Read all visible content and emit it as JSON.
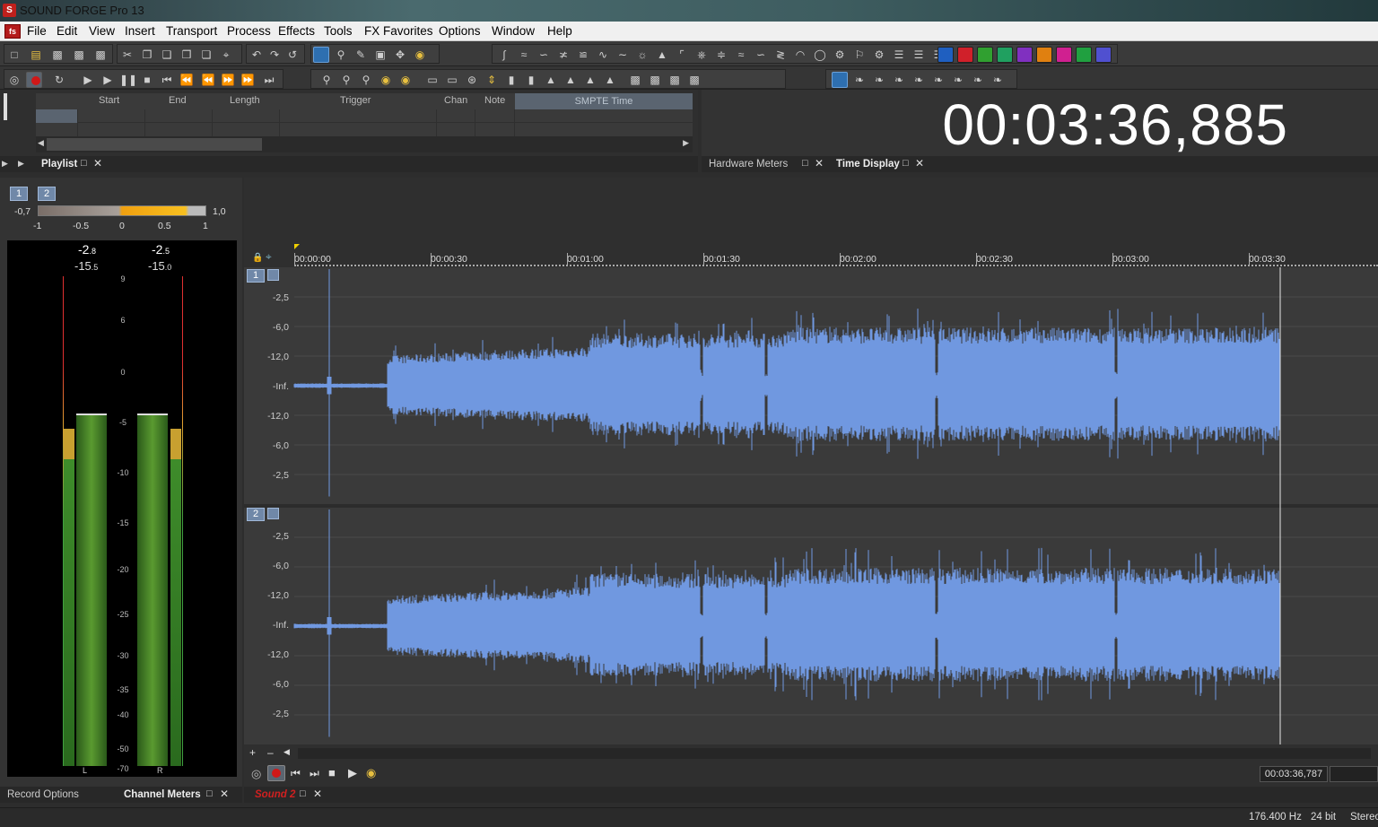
{
  "app": {
    "title": "SOUND FORGE Pro 13"
  },
  "menu": [
    "File",
    "Edit",
    "View",
    "Insert",
    "Transport",
    "Process",
    "Effects",
    "Tools",
    "FX Favorites",
    "Options",
    "Window",
    "Help"
  ],
  "playlist": {
    "columns": [
      "Start",
      "End",
      "Length",
      "Trigger",
      "Chan",
      "Note",
      "SMPTE Time"
    ],
    "tab": "Playlist"
  },
  "time_display": {
    "value": "00:03:36,885",
    "tabs": [
      "Hardware Meters",
      "Time Display"
    ]
  },
  "channel_meters": {
    "channels": [
      "1",
      "2"
    ],
    "balance": {
      "left": "-0,7",
      "right": "1,0",
      "scale": [
        "-1",
        "-0.5",
        "0",
        "0.5",
        "1"
      ]
    },
    "peak_left": {
      "big": "-2",
      "small": ".8"
    },
    "peak_right": {
      "big": "-2",
      "small": ".5"
    },
    "rms_left": {
      "big": "-15",
      "small": ".5"
    },
    "rms_right": {
      "big": "-15",
      "small": ".0"
    },
    "scale": [
      "9",
      "6",
      "0",
      "-5",
      "-10",
      "-15",
      "-20",
      "-25",
      "-30",
      "-35",
      "-40",
      "-50",
      "-70"
    ],
    "left_label": "L",
    "right_label": "R",
    "level_left": 0.72,
    "level_right": 0.72,
    "tabs": [
      "Record Options",
      "Channel Meters"
    ]
  },
  "ruler": [
    "00:00:00",
    "00:00:30",
    "00:01:00",
    "00:01:30",
    "00:02:00",
    "00:02:30",
    "00:03:00",
    "00:03:30"
  ],
  "tracks": [
    {
      "label": "1",
      "db": [
        "-2,5",
        "-6,0",
        "-12,0",
        "-Inf.",
        "-12,0",
        "-6,0",
        "-2,5"
      ]
    },
    {
      "label": "2",
      "db": [
        "-2,5",
        "-6,0",
        "-12,0",
        "-Inf.",
        "-12,0",
        "-6,0",
        "-2,5"
      ]
    }
  ],
  "data_window": {
    "selection_time": "00:03:36,787",
    "tab": "Sound 2"
  },
  "status": {
    "rate": "176.400 Hz",
    "bits": "24 bit",
    "channels": "Stereo"
  },
  "colors": {
    "waveform": "#7098e0",
    "record": "#d01818",
    "accent": "#5a6470"
  }
}
